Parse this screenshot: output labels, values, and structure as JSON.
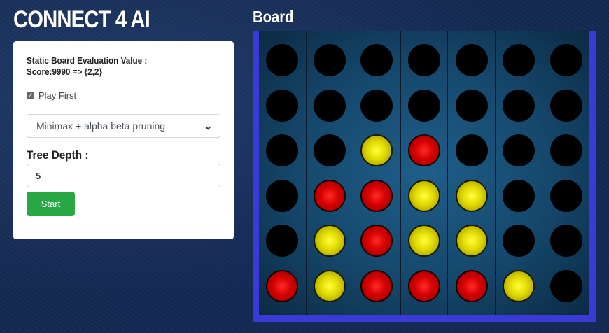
{
  "header": {
    "title": "CONNECT 4 AI"
  },
  "panel": {
    "eval_line1": "Static Board Evaluation Value :",
    "eval_line2": "Score:9990 => {2,2}",
    "play_first_label": "Play First",
    "play_first_checked": true,
    "algorithm_selected": "Minimax + alpha beta pruning",
    "tree_depth_label": "Tree Depth :",
    "tree_depth_value": "5",
    "start_label": "Start"
  },
  "board": {
    "title": "Board",
    "columns": 7,
    "rows": 6,
    "cells": [
      [
        "empty",
        "empty",
        "empty",
        "empty",
        "empty",
        "empty",
        "empty"
      ],
      [
        "empty",
        "empty",
        "empty",
        "empty",
        "empty",
        "empty",
        "empty"
      ],
      [
        "empty",
        "empty",
        "yellow",
        "red",
        "empty",
        "empty",
        "empty"
      ],
      [
        "empty",
        "red",
        "red",
        "yellow",
        "yellow",
        "empty",
        "empty"
      ],
      [
        "empty",
        "yellow",
        "red",
        "yellow",
        "yellow",
        "empty",
        "empty"
      ],
      [
        "red",
        "yellow",
        "red",
        "red",
        "red",
        "yellow",
        "empty"
      ]
    ],
    "colors": {
      "frame": "#3a3ad6",
      "red": "#d40000",
      "yellow": "#e0d800",
      "empty": "#000000"
    }
  }
}
